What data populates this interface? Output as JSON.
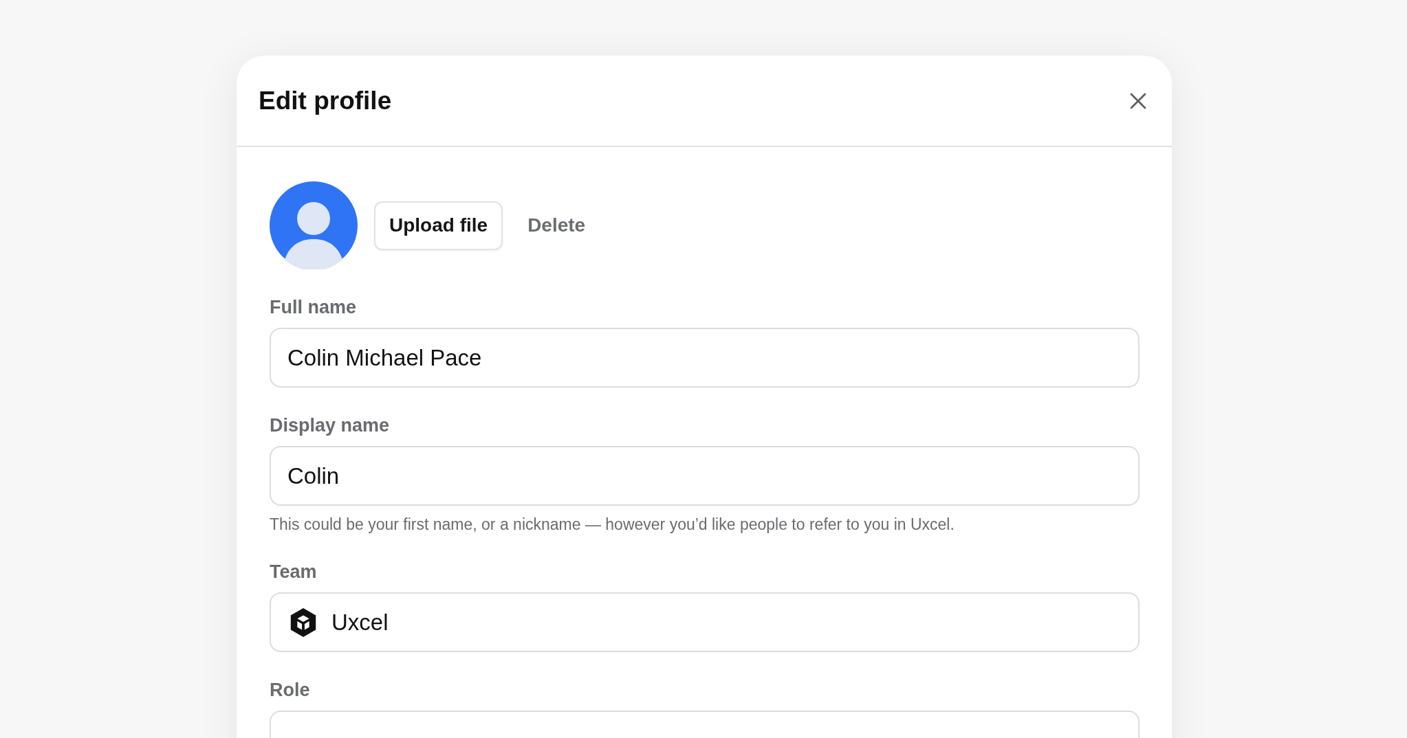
{
  "dialog": {
    "title": "Edit profile"
  },
  "avatar": {
    "actions": [
      {
        "label": "Upload file",
        "kind": "outlined"
      },
      {
        "label": "Delete",
        "kind": "plain"
      }
    ]
  },
  "fields": [
    {
      "label": "Full name",
      "kind": "text",
      "value": "Colin Michael Pace"
    },
    {
      "label": "Display name",
      "kind": "text",
      "value": "Colin",
      "help": "This could be your first name, or a nickname — however you’d like people to refer to you in Uxcel."
    },
    {
      "label": "Team",
      "kind": "team",
      "value": "Uxcel"
    },
    {
      "label": "Role",
      "kind": "text"
    }
  ]
}
